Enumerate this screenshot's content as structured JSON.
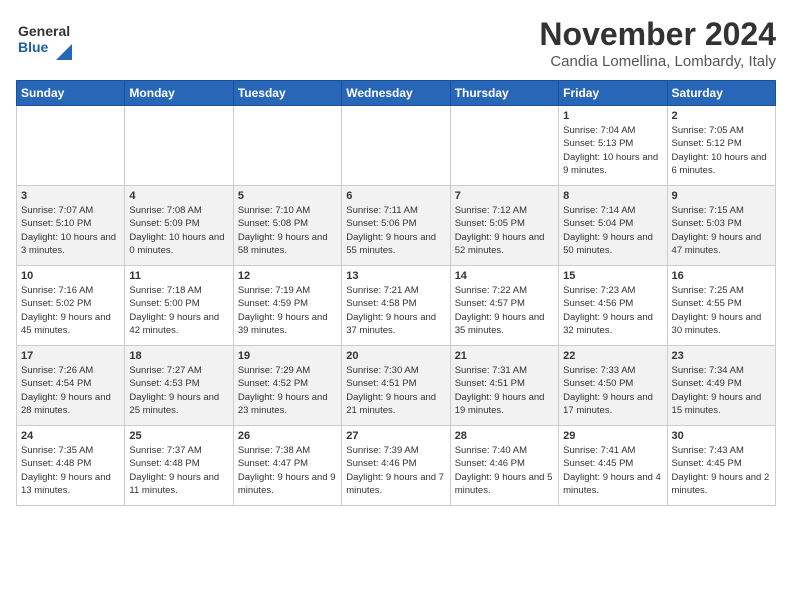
{
  "logo": {
    "line1": "General",
    "line2": "Blue"
  },
  "title": "November 2024",
  "location": "Candia Lomellina, Lombardy, Italy",
  "days_of_week": [
    "Sunday",
    "Monday",
    "Tuesday",
    "Wednesday",
    "Thursday",
    "Friday",
    "Saturday"
  ],
  "weeks": [
    [
      {
        "day": "",
        "info": ""
      },
      {
        "day": "",
        "info": ""
      },
      {
        "day": "",
        "info": ""
      },
      {
        "day": "",
        "info": ""
      },
      {
        "day": "",
        "info": ""
      },
      {
        "day": "1",
        "info": "Sunrise: 7:04 AM\nSunset: 5:13 PM\nDaylight: 10 hours and 9 minutes."
      },
      {
        "day": "2",
        "info": "Sunrise: 7:05 AM\nSunset: 5:12 PM\nDaylight: 10 hours and 6 minutes."
      }
    ],
    [
      {
        "day": "3",
        "info": "Sunrise: 7:07 AM\nSunset: 5:10 PM\nDaylight: 10 hours and 3 minutes."
      },
      {
        "day": "4",
        "info": "Sunrise: 7:08 AM\nSunset: 5:09 PM\nDaylight: 10 hours and 0 minutes."
      },
      {
        "day": "5",
        "info": "Sunrise: 7:10 AM\nSunset: 5:08 PM\nDaylight: 9 hours and 58 minutes."
      },
      {
        "day": "6",
        "info": "Sunrise: 7:11 AM\nSunset: 5:06 PM\nDaylight: 9 hours and 55 minutes."
      },
      {
        "day": "7",
        "info": "Sunrise: 7:12 AM\nSunset: 5:05 PM\nDaylight: 9 hours and 52 minutes."
      },
      {
        "day": "8",
        "info": "Sunrise: 7:14 AM\nSunset: 5:04 PM\nDaylight: 9 hours and 50 minutes."
      },
      {
        "day": "9",
        "info": "Sunrise: 7:15 AM\nSunset: 5:03 PM\nDaylight: 9 hours and 47 minutes."
      }
    ],
    [
      {
        "day": "10",
        "info": "Sunrise: 7:16 AM\nSunset: 5:02 PM\nDaylight: 9 hours and 45 minutes."
      },
      {
        "day": "11",
        "info": "Sunrise: 7:18 AM\nSunset: 5:00 PM\nDaylight: 9 hours and 42 minutes."
      },
      {
        "day": "12",
        "info": "Sunrise: 7:19 AM\nSunset: 4:59 PM\nDaylight: 9 hours and 39 minutes."
      },
      {
        "day": "13",
        "info": "Sunrise: 7:21 AM\nSunset: 4:58 PM\nDaylight: 9 hours and 37 minutes."
      },
      {
        "day": "14",
        "info": "Sunrise: 7:22 AM\nSunset: 4:57 PM\nDaylight: 9 hours and 35 minutes."
      },
      {
        "day": "15",
        "info": "Sunrise: 7:23 AM\nSunset: 4:56 PM\nDaylight: 9 hours and 32 minutes."
      },
      {
        "day": "16",
        "info": "Sunrise: 7:25 AM\nSunset: 4:55 PM\nDaylight: 9 hours and 30 minutes."
      }
    ],
    [
      {
        "day": "17",
        "info": "Sunrise: 7:26 AM\nSunset: 4:54 PM\nDaylight: 9 hours and 28 minutes."
      },
      {
        "day": "18",
        "info": "Sunrise: 7:27 AM\nSunset: 4:53 PM\nDaylight: 9 hours and 25 minutes."
      },
      {
        "day": "19",
        "info": "Sunrise: 7:29 AM\nSunset: 4:52 PM\nDaylight: 9 hours and 23 minutes."
      },
      {
        "day": "20",
        "info": "Sunrise: 7:30 AM\nSunset: 4:51 PM\nDaylight: 9 hours and 21 minutes."
      },
      {
        "day": "21",
        "info": "Sunrise: 7:31 AM\nSunset: 4:51 PM\nDaylight: 9 hours and 19 minutes."
      },
      {
        "day": "22",
        "info": "Sunrise: 7:33 AM\nSunset: 4:50 PM\nDaylight: 9 hours and 17 minutes."
      },
      {
        "day": "23",
        "info": "Sunrise: 7:34 AM\nSunset: 4:49 PM\nDaylight: 9 hours and 15 minutes."
      }
    ],
    [
      {
        "day": "24",
        "info": "Sunrise: 7:35 AM\nSunset: 4:48 PM\nDaylight: 9 hours and 13 minutes."
      },
      {
        "day": "25",
        "info": "Sunrise: 7:37 AM\nSunset: 4:48 PM\nDaylight: 9 hours and 11 minutes."
      },
      {
        "day": "26",
        "info": "Sunrise: 7:38 AM\nSunset: 4:47 PM\nDaylight: 9 hours and 9 minutes."
      },
      {
        "day": "27",
        "info": "Sunrise: 7:39 AM\nSunset: 4:46 PM\nDaylight: 9 hours and 7 minutes."
      },
      {
        "day": "28",
        "info": "Sunrise: 7:40 AM\nSunset: 4:46 PM\nDaylight: 9 hours and 5 minutes."
      },
      {
        "day": "29",
        "info": "Sunrise: 7:41 AM\nSunset: 4:45 PM\nDaylight: 9 hours and 4 minutes."
      },
      {
        "day": "30",
        "info": "Sunrise: 7:43 AM\nSunset: 4:45 PM\nDaylight: 9 hours and 2 minutes."
      }
    ]
  ]
}
